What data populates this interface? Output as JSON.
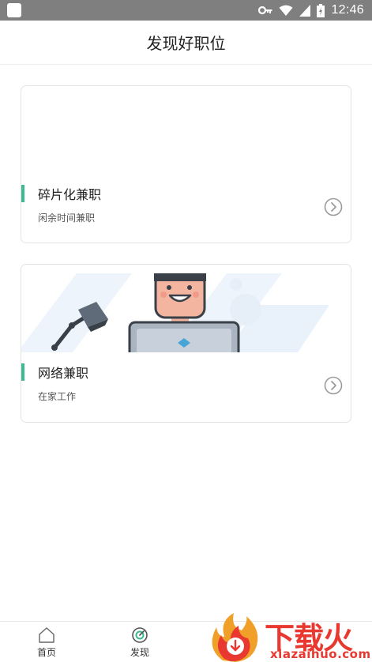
{
  "status_bar": {
    "time": "12:46",
    "icons": [
      "app-notification-icon",
      "key-icon",
      "wifi-icon",
      "signal-icon",
      "battery-icon"
    ]
  },
  "header": {
    "title": "发现好职位"
  },
  "cards": [
    {
      "title": "碎片化兼职",
      "subtitle": "闲余时间兼职",
      "icon": "chevron-right-circle-icon"
    },
    {
      "title": "网络兼职",
      "subtitle": "在家工作",
      "icon": "chevron-right-circle-icon",
      "image": "illustration-person-laptop"
    }
  ],
  "bottom_nav": {
    "items": [
      {
        "label": "首页",
        "icon": "home-icon"
      },
      {
        "label": "发现",
        "icon": "discover-icon"
      }
    ]
  },
  "watermark": {
    "logo": "下载火",
    "url": "xiazaihuo.com"
  },
  "colors": {
    "accent": "#3dbb8f",
    "status_bar": "#7f7f7f",
    "watermark": "#e8382f"
  }
}
